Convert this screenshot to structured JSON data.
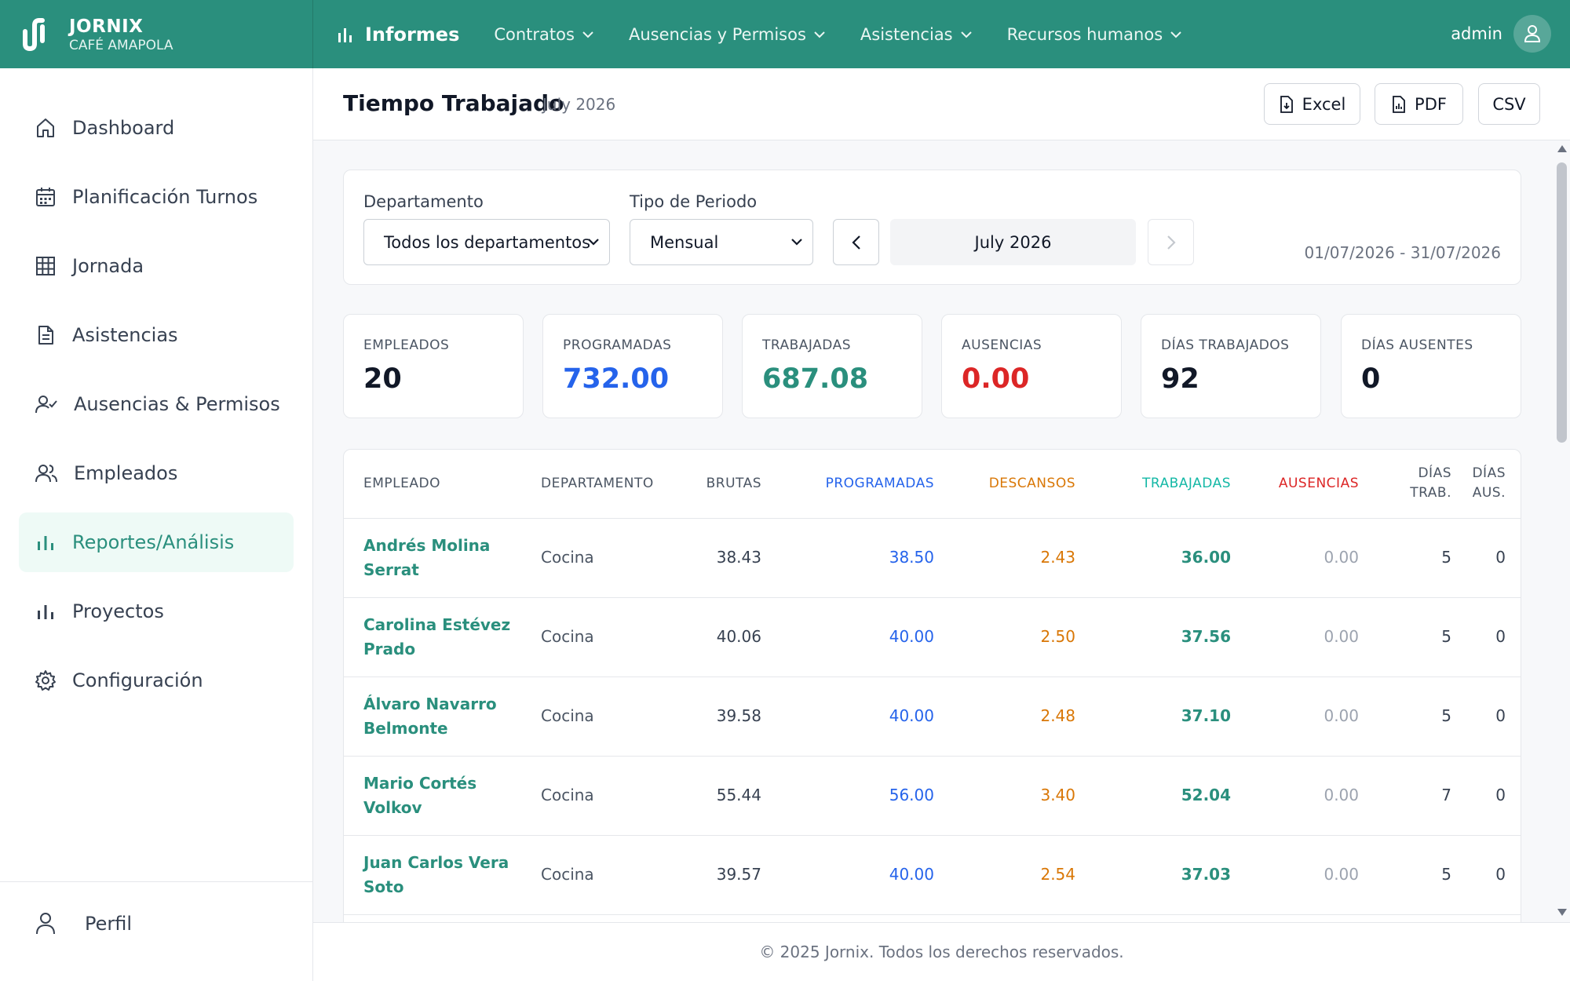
{
  "brand": {
    "name": "JORNIX",
    "subtitle": "CAFÉ AMAPOLA"
  },
  "topnav": {
    "active": "Informes",
    "items": [
      "Contratos",
      "Ausencias y Permisos",
      "Asistencias",
      "Recursos humanos"
    ],
    "user": "admin"
  },
  "sidebar": {
    "items": [
      "Dashboard",
      "Planificación Turnos",
      "Jornada",
      "Asistencias",
      "Ausencias & Permisos",
      "Empleados",
      "Reportes/Análisis",
      "Proyectos",
      "Configuración"
    ],
    "active": "Reportes/Análisis",
    "profile": "Perfil"
  },
  "header": {
    "title": "Tiempo Trabajado",
    "period": "July 2026",
    "exports": [
      "Excel",
      "PDF",
      "CSV"
    ]
  },
  "filters": {
    "department_label": "Departamento",
    "department_value": "Todos los departamentos",
    "period_type_label": "Tipo de Periodo",
    "period_type_value": "Mensual",
    "period_display": "July 2026",
    "date_range": "01/07/2026 - 31/07/2026"
  },
  "stats": [
    {
      "label": "EMPLEADOS",
      "value": "20",
      "color": "#111827"
    },
    {
      "label": "PROGRAMADAS",
      "value": "732.00",
      "color": "#2563eb"
    },
    {
      "label": "TRABAJADAS",
      "value": "687.08",
      "color": "#2a8f7d"
    },
    {
      "label": "AUSENCIAS",
      "value": "0.00",
      "color": "#dc2626"
    },
    {
      "label": "DÍAS TRABAJADOS",
      "value": "92",
      "color": "#111827"
    },
    {
      "label": "DÍAS AUSENTES",
      "value": "0",
      "color": "#111827"
    }
  ],
  "table": {
    "headers": {
      "empleado": "EMPLEADO",
      "departamento": "DEPARTAMENTO",
      "brutas": "BRUTAS",
      "programadas": "PROGRAMADAS",
      "descansos": "DESCANSOS",
      "trabajadas": "TRABAJADAS",
      "ausencias": "AUSENCIAS",
      "dias_trab_1": "DÍAS",
      "dias_trab_2": "TRAB.",
      "dias_aus_1": "DÍAS",
      "dias_aus_2": "AUS."
    },
    "rows": [
      {
        "name1": "Andrés Molina",
        "name2": "Serrat",
        "dept": "Cocina",
        "brutas": "38.43",
        "programadas": "38.50",
        "descansos": "2.43",
        "trabajadas": "36.00",
        "ausencias": "0.00",
        "dias_trab": "5",
        "dias_aus": "0"
      },
      {
        "name1": "Carolina Estévez",
        "name2": "Prado",
        "dept": "Cocina",
        "brutas": "40.06",
        "programadas": "40.00",
        "descansos": "2.50",
        "trabajadas": "37.56",
        "ausencias": "0.00",
        "dias_trab": "5",
        "dias_aus": "0"
      },
      {
        "name1": "Álvaro Navarro",
        "name2": "Belmonte",
        "dept": "Cocina",
        "brutas": "39.58",
        "programadas": "40.00",
        "descansos": "2.48",
        "trabajadas": "37.10",
        "ausencias": "0.00",
        "dias_trab": "5",
        "dias_aus": "0"
      },
      {
        "name1": "Mario Cortés",
        "name2": "Volkov",
        "dept": "Cocina",
        "brutas": "55.44",
        "programadas": "56.00",
        "descansos": "3.40",
        "trabajadas": "52.04",
        "ausencias": "0.00",
        "dias_trab": "7",
        "dias_aus": "0"
      },
      {
        "name1": "Juan Carlos Vera",
        "name2": "Soto",
        "dept": "Cocina",
        "brutas": "39.57",
        "programadas": "40.00",
        "descansos": "2.54",
        "trabajadas": "37.03",
        "ausencias": "0.00",
        "dias_trab": "5",
        "dias_aus": "0"
      }
    ]
  },
  "colors": {
    "brand": "#2a8f7d",
    "programadas": "#2563eb",
    "descansos": "#d97706",
    "trabajadas_header": "#14b8a6",
    "ausencias": "#dc2626"
  },
  "footer": "© 2025 Jornix. Todos los derechos reservados."
}
